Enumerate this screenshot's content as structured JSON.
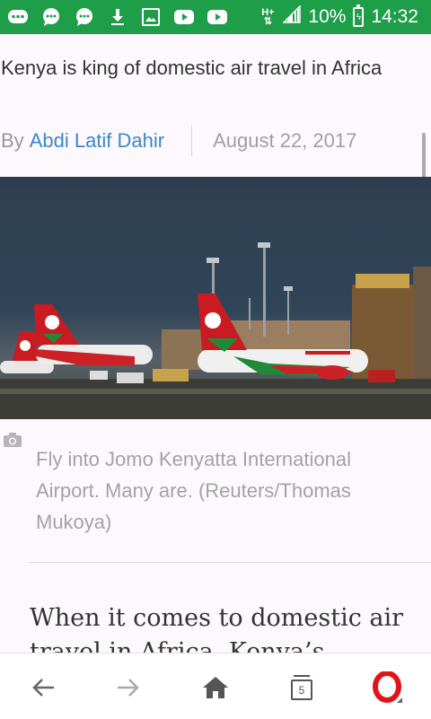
{
  "status_bar": {
    "battery_percent": "10%",
    "time": "14:32",
    "network": "H+",
    "notification_icons": [
      "bbm-icon",
      "chat-icon",
      "chat-icon",
      "download-icon",
      "image-icon",
      "youtube-icon",
      "youtube-icon"
    ]
  },
  "article": {
    "title": "Kenya is king of domestic air travel in Africa",
    "byline_prefix": "By",
    "author": "Abdi Latif Dahir",
    "date": "August 22, 2017",
    "photo_caption": "Fly into Jomo Kenyatta International Airport. Many are. (Reuters/Thomas Mukoya)",
    "body_start": "When it comes to domestic air travel in Africa, Kenya’s"
  },
  "bottom_nav": {
    "tab_count": "5"
  },
  "colors": {
    "status_bar": "#1f9e4a",
    "link": "#3a89c8",
    "opera_red": "#e0151b"
  }
}
